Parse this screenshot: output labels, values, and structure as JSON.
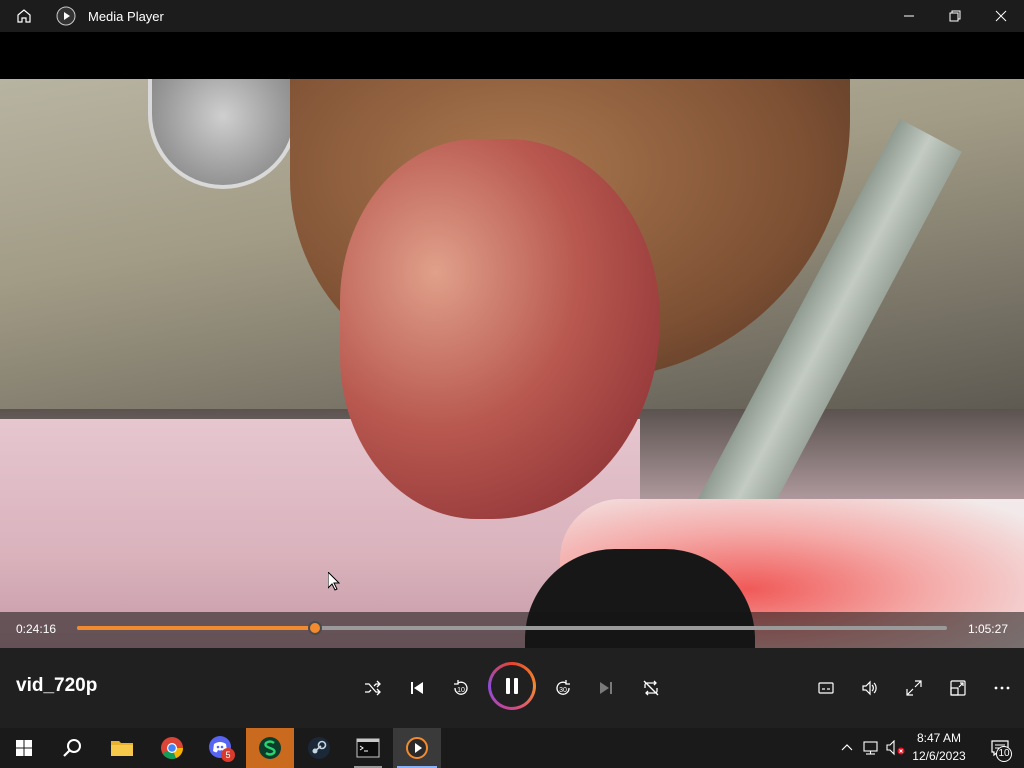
{
  "window": {
    "title": "Media Player"
  },
  "player": {
    "video_title": "vid_720p",
    "current_time": "0:24:16",
    "total_time": "1:05:27",
    "progress": 0.2736,
    "skip_back_seconds": "10",
    "skip_forward_seconds": "30"
  },
  "colors": {
    "accent": "#f28b30",
    "titlebar": "#1c1c1c",
    "controls_bg": "#202020",
    "taskbar": "#1a1a1a"
  },
  "taskbar": {
    "apps": [
      {
        "name": "start-icon"
      },
      {
        "name": "search-icon"
      },
      {
        "name": "file-explorer-icon"
      },
      {
        "name": "chrome-icon"
      },
      {
        "name": "discord-icon",
        "badge": "5"
      },
      {
        "name": "app-s-icon"
      },
      {
        "name": "steam-icon"
      },
      {
        "name": "terminal-icon"
      },
      {
        "name": "media-player-icon"
      }
    ],
    "clock_time": "8:47 AM",
    "clock_date": "12/6/2023",
    "notification_count": "10"
  }
}
